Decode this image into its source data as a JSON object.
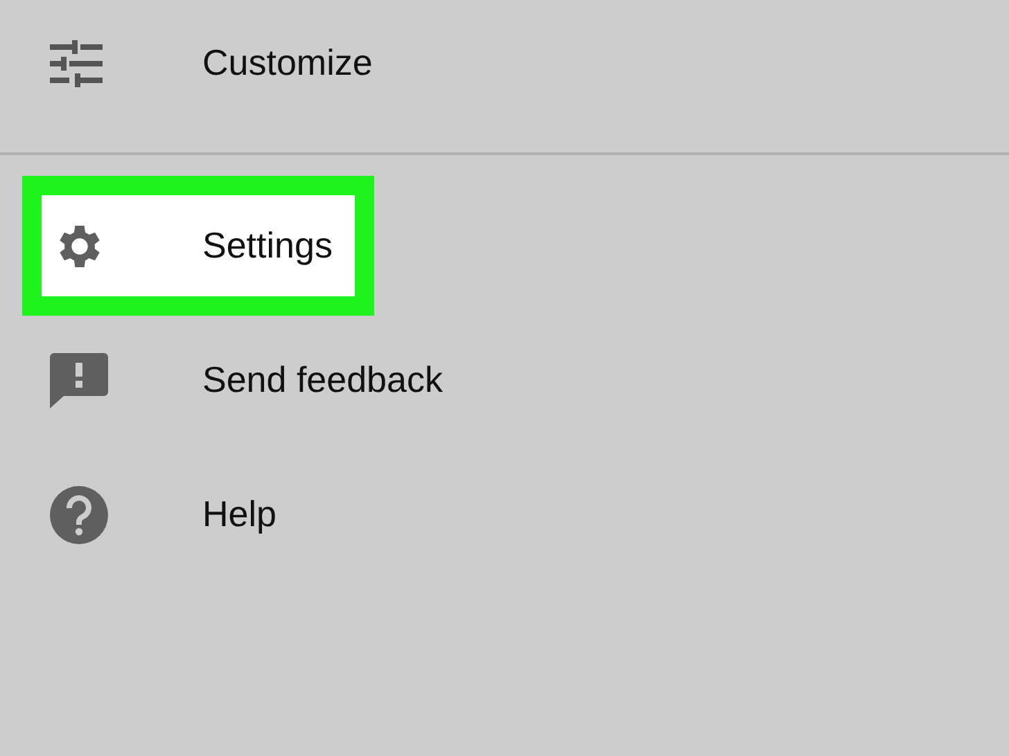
{
  "menu": {
    "sections": [
      {
        "items": [
          {
            "label": "Customize",
            "highlighted": false
          }
        ]
      },
      {
        "items": [
          {
            "label": "Settings",
            "highlighted": true
          },
          {
            "label": "Send feedback",
            "highlighted": false
          },
          {
            "label": "Help",
            "highlighted": false
          }
        ]
      }
    ]
  }
}
